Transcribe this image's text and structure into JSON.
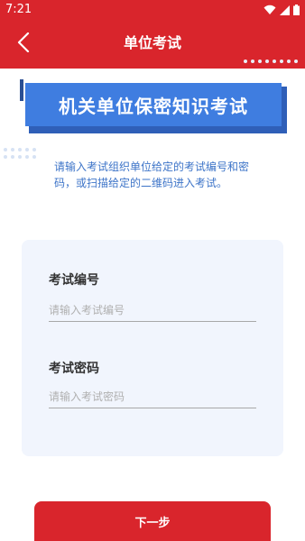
{
  "status_bar": {
    "time": "7:21"
  },
  "app_bar": {
    "title": "单位考试",
    "back_icon": "chevron-left-icon"
  },
  "banner": {
    "title": "机关单位保密知识考试"
  },
  "intro_text": "请输入考试组织单位给定的考试编号和密码，或扫描给定的二维码进入考试。",
  "form": {
    "exam_number": {
      "label": "考试编号",
      "placeholder": "请输入考试编号",
      "value": ""
    },
    "exam_password": {
      "label": "考试密码",
      "placeholder": "请输入考试密码",
      "value": ""
    }
  },
  "actions": {
    "next_label": "下一步"
  },
  "colors": {
    "primary_red": "#d9252c",
    "banner_blue": "#3f7de0",
    "intro_blue": "#3d74c8",
    "card_bg": "#f1f5fd"
  }
}
